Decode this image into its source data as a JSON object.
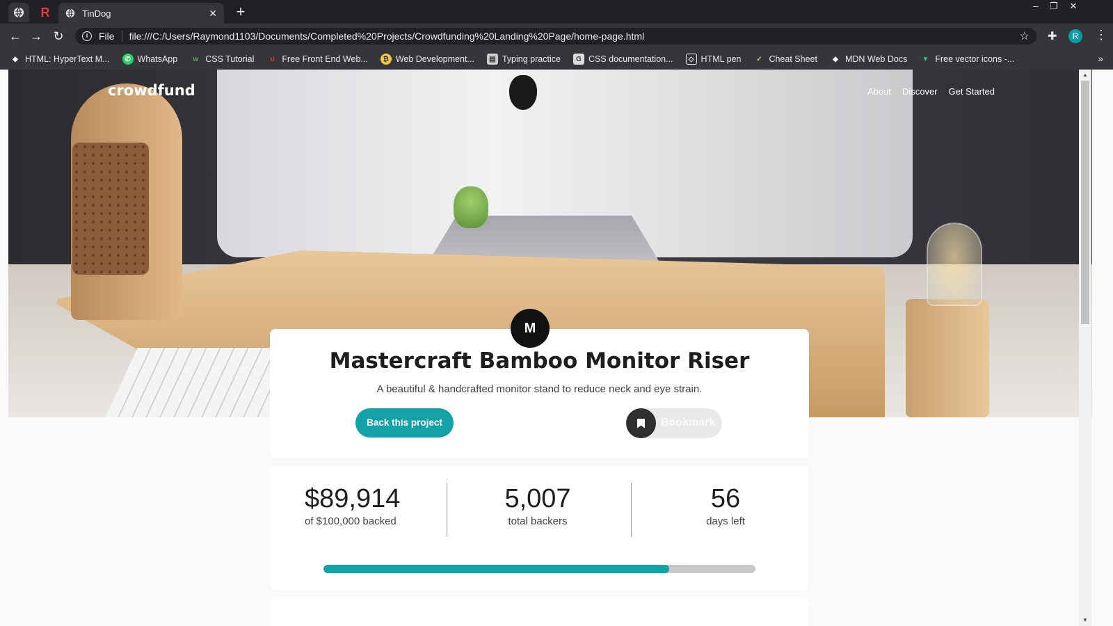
{
  "browser": {
    "tab_title": "TinDog",
    "pinned_tab_letter": "R",
    "address_prefix": "File",
    "url": "file:///C:/Users/Raymond1103/Documents/Completed%20Projects/Crowdfunding%20Landing%20Page/home-page.html",
    "profile_initial": "R",
    "bookmarks": [
      {
        "label": "HTML: HyperText M...",
        "icon": "mdn-icon"
      },
      {
        "label": "WhatsApp",
        "icon": "whatsapp-icon"
      },
      {
        "label": "CSS Tutorial",
        "icon": "w3schools-icon"
      },
      {
        "label": "Free Front End Web...",
        "icon": "u-icon"
      },
      {
        "label": "Web Development...",
        "icon": "bitcoin-icon"
      },
      {
        "label": "Typing practice",
        "icon": "typing-icon"
      },
      {
        "label": "CSS documentation...",
        "icon": "css-icon"
      },
      {
        "label": "HTML pen",
        "icon": "codepen-icon"
      },
      {
        "label": "Cheat Sheet",
        "icon": "cheat-icon"
      },
      {
        "label": "MDN Web Docs",
        "icon": "mdn-icon"
      },
      {
        "label": "Free vector icons -...",
        "icon": "vector-icon"
      }
    ]
  },
  "site": {
    "logo": "crowdfund",
    "nav": [
      "About",
      "Discover",
      "Get Started"
    ]
  },
  "project": {
    "badge_text": "M",
    "title": "Mastercraft Bamboo Monitor Riser",
    "description": "A beautiful & handcrafted monitor stand to reduce neck and eye strain.",
    "back_label": "Back this project",
    "bookmark_label": "Bookmark"
  },
  "stats": {
    "backed_value": "$89,914",
    "backed_label": "of $100,000 backed",
    "backers_value": "5,007",
    "backers_label": "total backers",
    "days_value": "56",
    "days_label": "days left",
    "progress_fraction": 0.8
  },
  "colors": {
    "accent": "#14a2a9",
    "dark": "#1e1e1e"
  }
}
